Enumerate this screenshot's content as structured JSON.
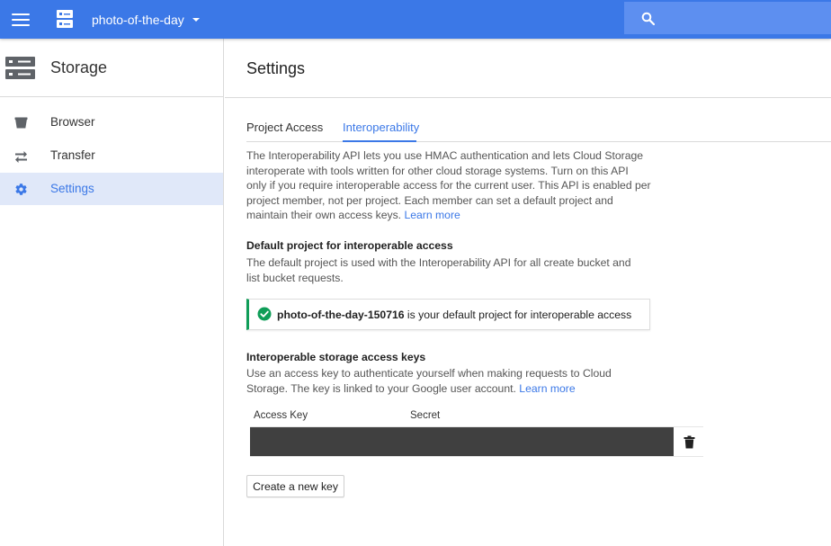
{
  "topbar": {
    "project_name": "photo-of-the-day",
    "icons": {
      "menu": "menu-icon",
      "project": "server-icon",
      "dropdown": "caret-down-icon",
      "search": "search-icon"
    }
  },
  "sidebar": {
    "title": "Storage",
    "logo_icon": "storage-icon",
    "items": [
      {
        "label": "Browser",
        "icon": "bucket-icon",
        "active": false
      },
      {
        "label": "Transfer",
        "icon": "transfer-icon",
        "active": false
      },
      {
        "label": "Settings",
        "icon": "gear-icon",
        "active": true
      }
    ]
  },
  "main": {
    "title": "Settings",
    "tabs": [
      {
        "label": "Project Access",
        "active": false
      },
      {
        "label": "Interoperability",
        "active": true
      }
    ],
    "intro": {
      "text": "The Interoperability API lets you use HMAC authentication and lets Cloud Storage interoperate with tools written for other cloud storage systems. Turn on this API only if you require interoperable access for the current user. This API is enabled per project member, not per project. Each member can set a default project and maintain their own access keys.",
      "link": "Learn more"
    },
    "default_project": {
      "heading": "Default project for interoperable access",
      "text": "The default project is used with the Interoperability API for all create bucket and list bucket requests.",
      "notice_project": "photo-of-the-day-150716",
      "notice_text": " is your default project for interoperable access"
    },
    "access_keys": {
      "heading": "Interoperable storage access keys",
      "text": "Use an access key to authenticate yourself when making requests to Cloud Storage. The key is linked to your Google user account.",
      "link": "Learn more",
      "columns": [
        "Access Key",
        "Secret"
      ],
      "create_label": "Create a new key"
    }
  },
  "colors": {
    "primary": "#3b78e7",
    "success": "#0f9d58",
    "redacted": "#404040"
  }
}
